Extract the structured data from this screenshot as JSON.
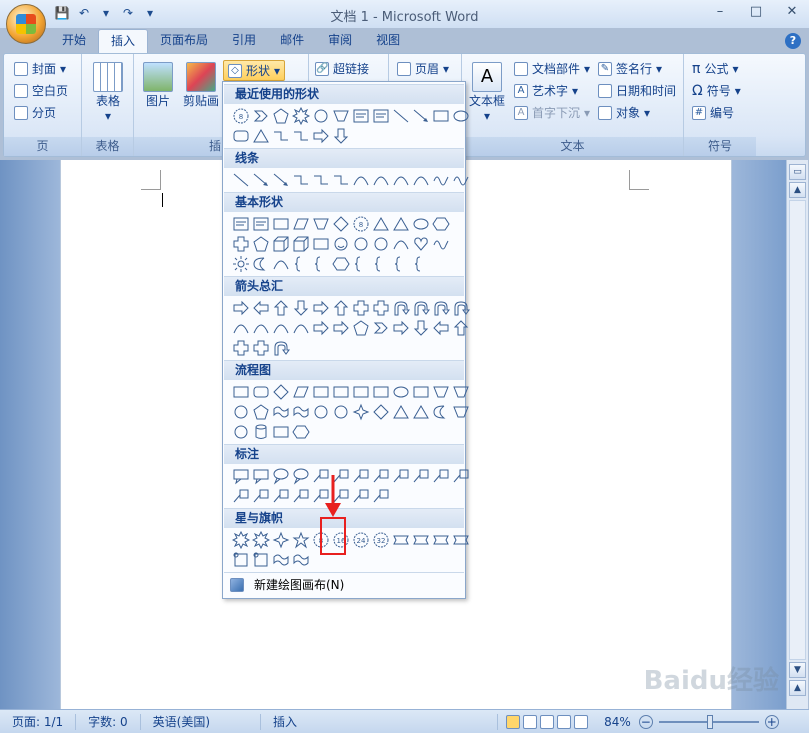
{
  "window": {
    "title": "文档 1 - Microsoft Word",
    "minimize": "–",
    "restore": "□",
    "close": "✕"
  },
  "tabs": [
    {
      "label": "开始"
    },
    {
      "label": "插入"
    },
    {
      "label": "页面布局"
    },
    {
      "label": "引用"
    },
    {
      "label": "邮件"
    },
    {
      "label": "审阅"
    },
    {
      "label": "视图"
    }
  ],
  "ribbon": {
    "page_group": {
      "label": "页",
      "cover": "封面",
      "blank": "空白页",
      "break": "分页"
    },
    "table_group": {
      "label": "表格",
      "table": "表格"
    },
    "illus_group": {
      "label": "插图",
      "picture": "图片",
      "clipart": "剪贴画",
      "shapes": "形状"
    },
    "link_group": {
      "hyperlink": "超链接"
    },
    "header_group": {
      "header": "页眉"
    },
    "text_group": {
      "label": "文本",
      "textbox": "文本框",
      "quickparts": "文档部件",
      "wordart": "艺术字",
      "dropcap": "首字下沉",
      "signature": "签名行",
      "datetime": "日期和时间",
      "object": "对象"
    },
    "symbol_group": {
      "label": "符号",
      "equation": "公式",
      "symbol": "符号",
      "number": "编号"
    }
  },
  "dropdown": {
    "sections": [
      "最近使用的形状",
      "线条",
      "基本形状",
      "箭头总汇",
      "流程图",
      "标注",
      "星与旗帜"
    ],
    "new_canvas": "新建绘图画布(N)",
    "badges": {
      "b8": "8",
      "b16": "16",
      "b24": "24",
      "b32": "32"
    }
  },
  "status": {
    "page": "页面: 1/1",
    "words": "字数: 0",
    "lang": "英语(美国)",
    "mode": "插入",
    "zoom": "84%"
  },
  "watermark": "Baidu经验"
}
